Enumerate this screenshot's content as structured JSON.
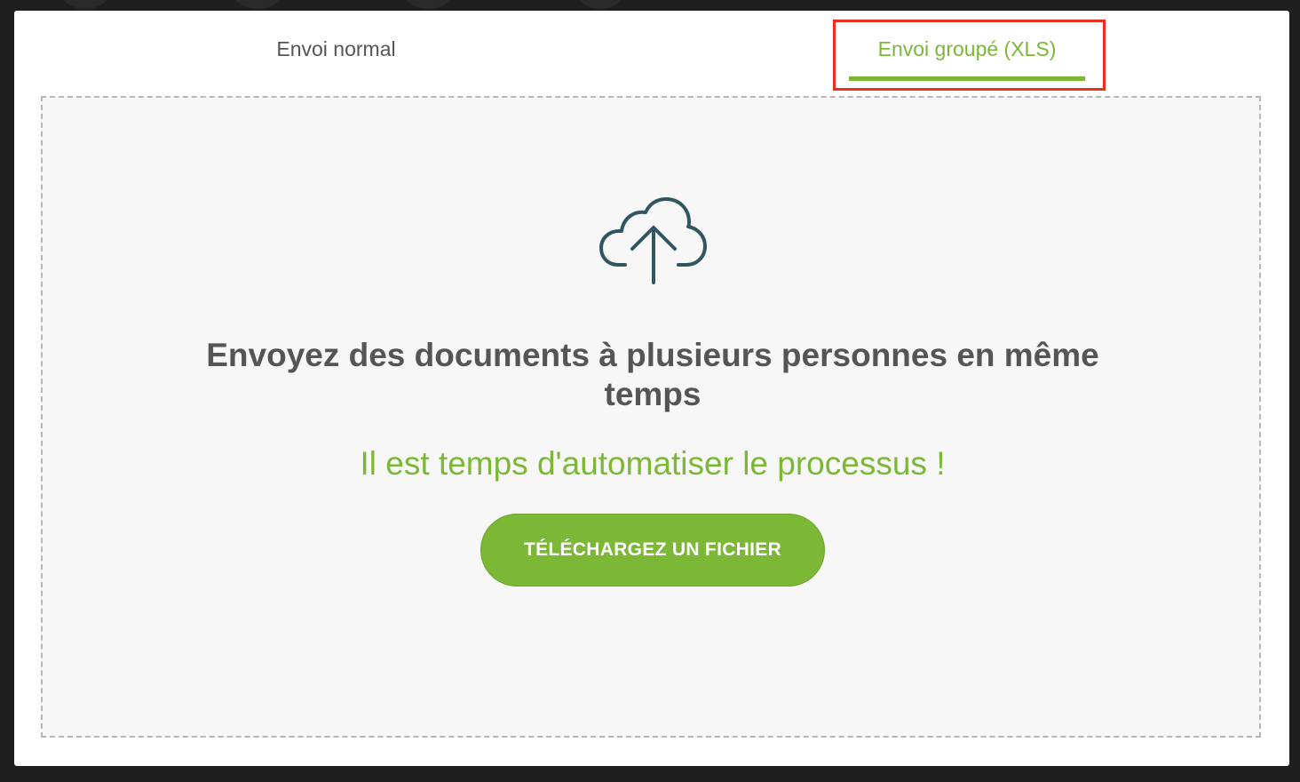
{
  "tabs": [
    {
      "label": "Envoi normal",
      "active": false
    },
    {
      "label": "Envoi groupé (XLS)",
      "active": true
    }
  ],
  "dropzone": {
    "icon": "cloud-upload-icon",
    "heading": "Envoyez des documents à plusieurs personnes en même temps",
    "tagline": "Il est temps d'automatiser le processus !",
    "button_label": "TÉLÉCHARGEZ UN FICHIER"
  },
  "colors": {
    "accent": "#7cb836",
    "text": "#555555",
    "highlight": "#e8301c",
    "icon": "#2f5661"
  }
}
